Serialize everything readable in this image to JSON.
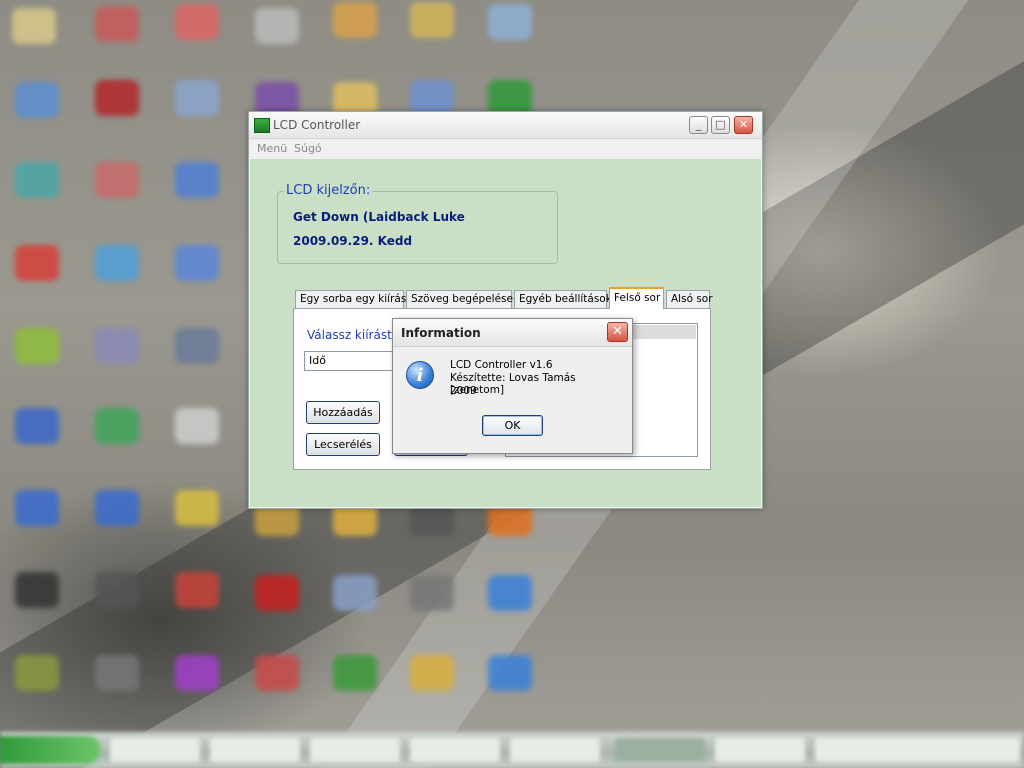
{
  "window": {
    "title": "LCD Controller",
    "minimize_glyph": "_",
    "maximize_glyph": "□",
    "close_glyph": "✕"
  },
  "menu": {
    "items": [
      "Menü",
      "Súgó"
    ]
  },
  "lcd_group": {
    "legend": "LCD kijelzőn:",
    "line1": "Get Down (Laidback Luke",
    "line2": "2009.09.29. Kedd"
  },
  "tabs": [
    {
      "label": "Egy sorba egy kiírás",
      "active": false
    },
    {
      "label": "Szöveg begépelése",
      "active": false
    },
    {
      "label": "Egyéb beállítások",
      "active": false
    },
    {
      "label": "Felső sor",
      "active": true
    },
    {
      "label": "Alsó sor",
      "active": false
    }
  ],
  "panel": {
    "choose_label": "Válassz kiírást",
    "combo_value": "Idő",
    "add_button": "Hozzáadás",
    "replace_button": "Lecserélés"
  },
  "dialog": {
    "title": "Information",
    "close_glyph": "✕",
    "icon": "information-icon",
    "icon_glyph": "i",
    "line1": "LCD Controller v1.6",
    "line2": "Készítette: Lovas Tamás [zenetom]",
    "line3": "2009",
    "ok_label": "OK"
  },
  "colors": {
    "client_background": "#c9e0c6",
    "label_blue": "#1d3fb5",
    "lcd_text": "#0a1d7a",
    "active_tab_accent": "#f0a030"
  }
}
